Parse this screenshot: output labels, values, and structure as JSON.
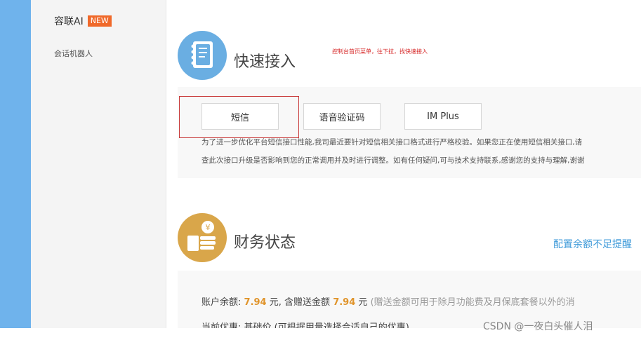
{
  "sidebar": {
    "title": "容联AI",
    "badge": "NEW",
    "items": [
      {
        "label": "会话机器人"
      }
    ]
  },
  "quick_access": {
    "icon": "notebook-icon",
    "title": "快速接入",
    "note": "控制台首页菜单，往下拉，找快速接入",
    "buttons": [
      {
        "label": "短信"
      },
      {
        "label": "语音验证码"
      },
      {
        "label": "IM Plus"
      }
    ],
    "notice_line1": "为了进一步优化平台短信接口性能,我司最近要针对短信相关接口格式进行严格校验。如果您正在使用短信相关接口,请",
    "notice_line2": "查此次接口升级是否影响到您的正常调用并及时进行调整。如有任何疑问,可与技术支持联系,感谢您的支持与理解,谢谢"
  },
  "finance": {
    "icon": "money-icon",
    "title": "财务状态",
    "config_link": "配置余额不足提醒",
    "balance_label": "账户余额:",
    "balance_value": "7.94",
    "unit1": "元,",
    "gift_label": "含赠送金额",
    "gift_value": "7.94",
    "unit2": "元",
    "gift_note": "(赠送金额可用于除月功能费及月保底套餐以外的消",
    "discount_line": "当前优惠:  基础价 (可根据用量选择合适自己的优惠)"
  },
  "watermark": "CSDN @一夜白头催人泪",
  "colors": {
    "sidebar_strip": "#6fb3ec",
    "badge": "#f0692a",
    "highlight_box": "#c83a3a",
    "amount": "#e0942b",
    "link": "#3e9ad9"
  }
}
